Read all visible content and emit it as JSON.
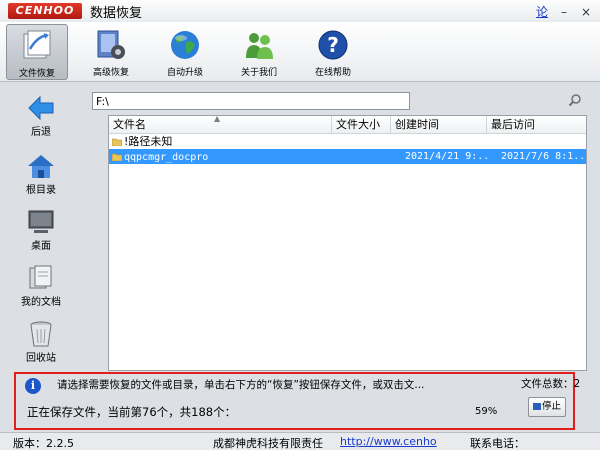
{
  "window": {
    "logo_text": "CENHOO",
    "title": "数据恢复",
    "help_link": "论",
    "close_glyph": "×"
  },
  "toolbar": {
    "items": [
      {
        "label": "文件恢复",
        "icon": "file-recovery-icon",
        "active": true
      },
      {
        "label": "高级恢复",
        "icon": "advanced-recovery-icon",
        "active": false
      },
      {
        "label": "自动升级",
        "icon": "globe-icon",
        "active": false
      },
      {
        "label": "关于我们",
        "icon": "people-icon",
        "active": false
      },
      {
        "label": "在线帮助",
        "icon": "help-icon",
        "active": false
      }
    ]
  },
  "nav": {
    "items": [
      {
        "label": "后退",
        "icon": "back-arrow-icon"
      },
      {
        "label": "根目录",
        "icon": "home-icon"
      },
      {
        "label": "桌面",
        "icon": "desktop-icon"
      },
      {
        "label": "我的文档",
        "icon": "documents-icon"
      },
      {
        "label": "回收站",
        "icon": "recycle-bin-icon"
      }
    ]
  },
  "path": {
    "value": "F:\\"
  },
  "table": {
    "columns": [
      "文件名",
      "文件大小",
      "创建时间",
      "最后访问"
    ],
    "rows": [
      {
        "name": "!路径未知",
        "size": "",
        "created": "",
        "accessed": "",
        "selected": false
      },
      {
        "name": "qqpcmgr_docpro",
        "size": "",
        "created": "2021/4/21 9:...",
        "accessed": "2021/7/6 8:1...",
        "selected": true
      }
    ]
  },
  "status": {
    "hint": "请选择需要恢复的文件或目录，单击右下方的“恢复”按钮保存文件，或双击文...",
    "file_count_label": "文件总数：",
    "file_count": "2",
    "progress_text": "正在保存文件，当前第76个，共188个：",
    "percent_text": "59%",
    "progress": 0.59,
    "stop_label": "停止"
  },
  "footer": {
    "version": "版本：2.2.5",
    "company": "成都神虎科技有限责任",
    "url": "http://www.cenho",
    "contact": "联系电话："
  },
  "colors": {
    "accent": "#3399ff",
    "highlight_border": "#e01e1e",
    "link": "#1a3cc8"
  }
}
